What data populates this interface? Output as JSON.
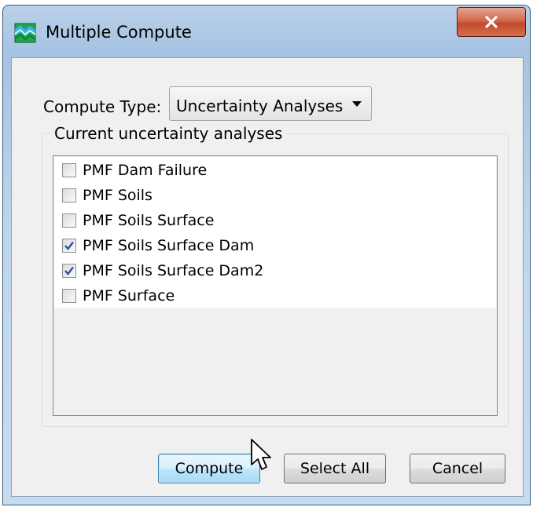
{
  "window": {
    "title": "Multiple Compute",
    "icon": "app-icon",
    "close_icon": "close-icon"
  },
  "compute_type": {
    "label": "Compute Type:",
    "selected": "Uncertainty Analyses"
  },
  "group": {
    "label": "Current uncertainty analyses",
    "items": [
      {
        "label": "PMF Dam Failure",
        "checked": false
      },
      {
        "label": "PMF Soils",
        "checked": false
      },
      {
        "label": "PMF Soils Surface",
        "checked": false
      },
      {
        "label": "PMF Soils Surface Dam",
        "checked": true
      },
      {
        "label": "PMF Soils Surface Dam2",
        "checked": true
      },
      {
        "label": "PMF Surface",
        "checked": false
      }
    ]
  },
  "buttons": {
    "compute": "Compute",
    "select_all": "Select All",
    "cancel": "Cancel"
  },
  "colors": {
    "check": "#2b4f9e",
    "close": "#c14a2c"
  }
}
